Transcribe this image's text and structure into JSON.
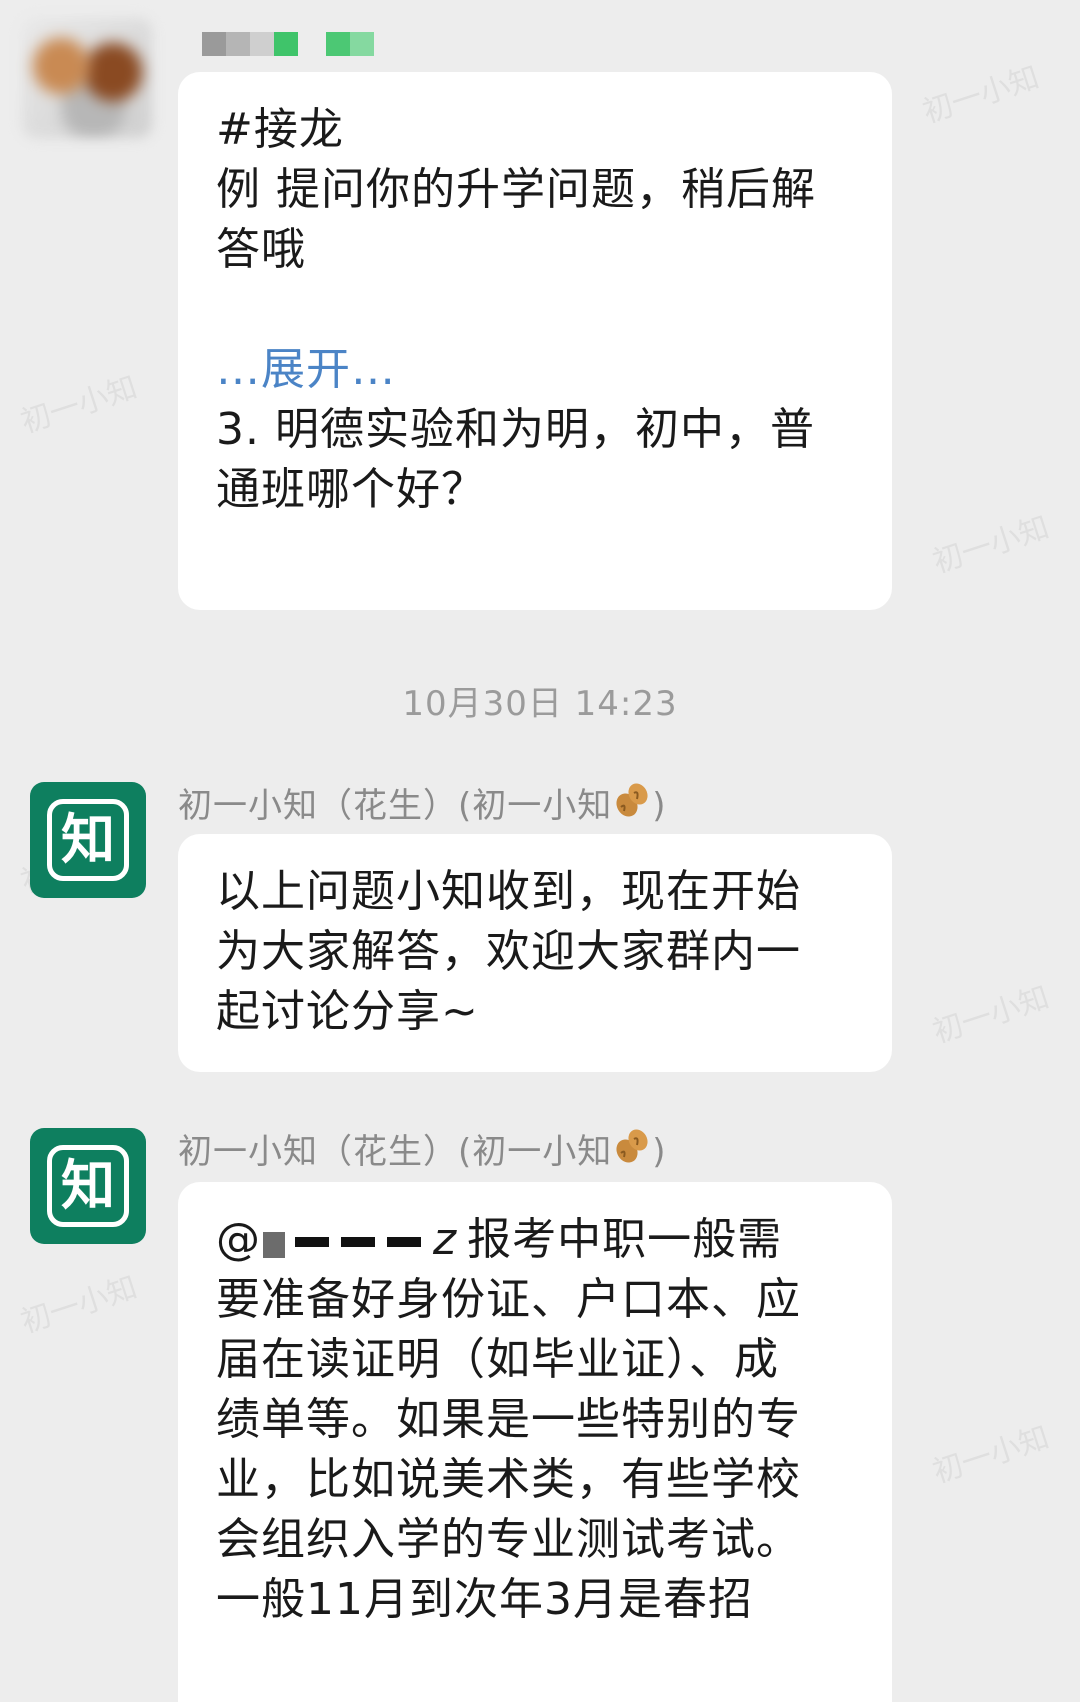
{
  "messages": [
    {
      "lines": [
        "#接龙",
        "例 提问你的升学问题，稍后解",
        "答哦",
        "",
        "",
        "3. 明德实验和为明，初中，普",
        "通班哪个好？"
      ],
      "expand_label": "…展开…"
    },
    {
      "sender": "初一小知（花生）(初一小知",
      "sender_suffix": ")",
      "lines": [
        "以上问题小知收到，现在开始",
        "为大家解答，欢迎大家群内一",
        "起讨论分享~"
      ]
    },
    {
      "sender": "初一小知（花生）(初一小知",
      "sender_suffix": ")",
      "mention_prefix": "@",
      "mention_suffix": "z",
      "first_line_rest": "报考中职一般需",
      "lines": [
        "要准备好身份证、户口本、应",
        "届在读证明（如毕业证）、成",
        "绩单等。如果是一些特别的专",
        "业，比如说美术类，有些学校",
        "会组织入学的专业测试考试。",
        "一般11月到次年3月是春招"
      ]
    }
  ],
  "time_divider": "10月30日 14:23",
  "avatar_glyph": "知",
  "watermarks": [
    "初一小知",
    "初一小知",
    "初一小知",
    "初一小知",
    "初一小知",
    "初一小知",
    "初一小知"
  ],
  "colors": {
    "background": "#ededed",
    "bubble": "#ffffff",
    "brand": "#0e7f5f",
    "link": "#4b84c6",
    "meta_text": "#8a8a8a"
  },
  "icons": [
    "peanut-icon"
  ]
}
